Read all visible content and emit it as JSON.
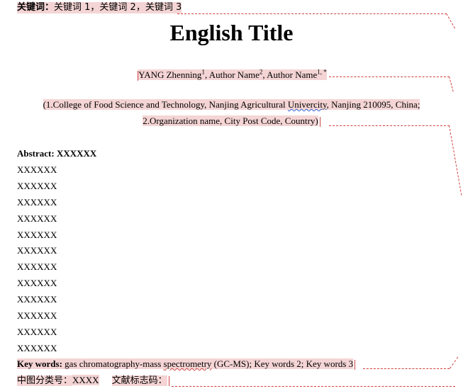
{
  "keywords_cn": {
    "label": "关键词：",
    "value": "关键词 1，关键词 2，关键词 3"
  },
  "title": "English Title",
  "authors": {
    "a1": "YANG Zhenning",
    "a1_sup": "1",
    "a2": ", Author Name",
    "a2_sup": "2",
    "a3": ", Author Name",
    "a3_sup": "1, *"
  },
  "affiliation": {
    "line1_a": "(1.College of Food Science and Technology, Nanjing Agricultural ",
    "line1_b": "Univercity",
    "line1_c": ", Nanjing 210095, China;",
    "line2": "2.Organization name, City Post Code, Country)"
  },
  "abstract": {
    "label": "Abstract:",
    "value": " XXXXXX"
  },
  "abstract_lines": [
    "XXXXXX",
    "XXXXXX",
    "XXXXXX",
    "XXXXXX",
    "XXXXXX",
    "XXXXXX",
    "XXXXXX",
    "XXXXXX",
    "XXXXXX",
    "XXXXXX",
    "XXXXXX",
    "XXXXXX"
  ],
  "keywords_en": {
    "label": "Key words:",
    "v1": " gas chromatography-mass ",
    "v2": "spectrometry",
    "v3": " (GC-MS); Key words 2; Key words 3"
  },
  "classification": {
    "clc_label": "中图分类号：",
    "clc_value": "XXXX",
    "doc_label": "文献标志码："
  },
  "colors": {
    "highlight": "#f4d4d4",
    "dash": "#d04040",
    "spell": "#3060d0"
  }
}
